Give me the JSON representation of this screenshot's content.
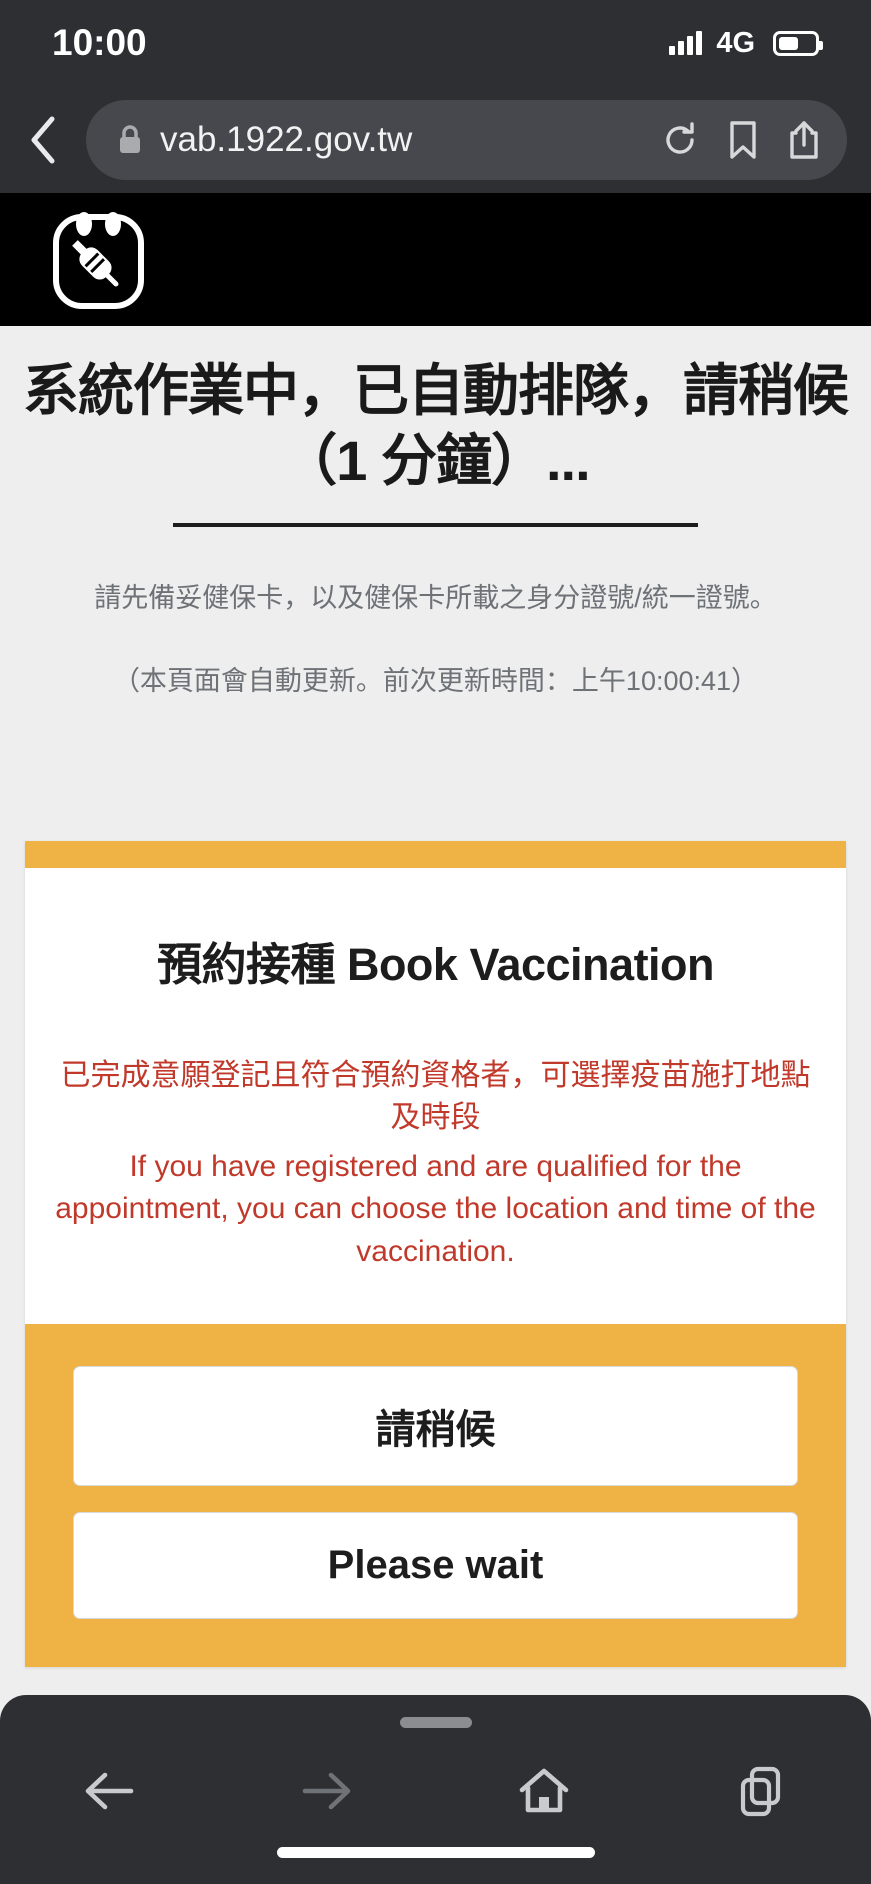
{
  "status_bar": {
    "time": "10:00",
    "network": "4G",
    "signal_icon": "signal-bars-icon",
    "battery_icon": "battery-icon"
  },
  "browser": {
    "back_icon": "chevron-left-icon",
    "lock_icon": "lock-icon",
    "url": "vab.1922.gov.tw",
    "reload_icon": "reload-icon",
    "bookmark_icon": "bookmark-icon",
    "share_icon": "share-icon"
  },
  "site_header": {
    "logo_icon": "vaccine-syringe-logo-icon"
  },
  "page": {
    "queue_heading": "系統作業中，已自動排隊，請稍候（1 分鐘）...",
    "sub_note": "請先備妥健保卡，以及健保卡所載之身分證號/統一證號。",
    "refresh_note": "（本頁面會自動更新。前次更新時間：上午10:00:41）",
    "card": {
      "title": "預約接種 Book Vaccination",
      "note_zh": "已完成意願登記且符合預約資格者，可選擇疫苗施打地點及時段",
      "note_en": "If you have registered and are qualified for the appointment, you can choose the location and time of the vaccination.",
      "button_zh": "請稍候",
      "button_en": "Please wait"
    }
  },
  "bottom_nav": {
    "back_icon": "arrow-left-icon",
    "forward_icon": "arrow-right-icon",
    "home_icon": "home-icon",
    "tabs_icon": "tabs-icon"
  },
  "colors": {
    "accent_orange": "#efb345",
    "alert_red": "#c0392b",
    "chrome_dark": "#2d2f33",
    "page_bg": "#eeeeee"
  }
}
